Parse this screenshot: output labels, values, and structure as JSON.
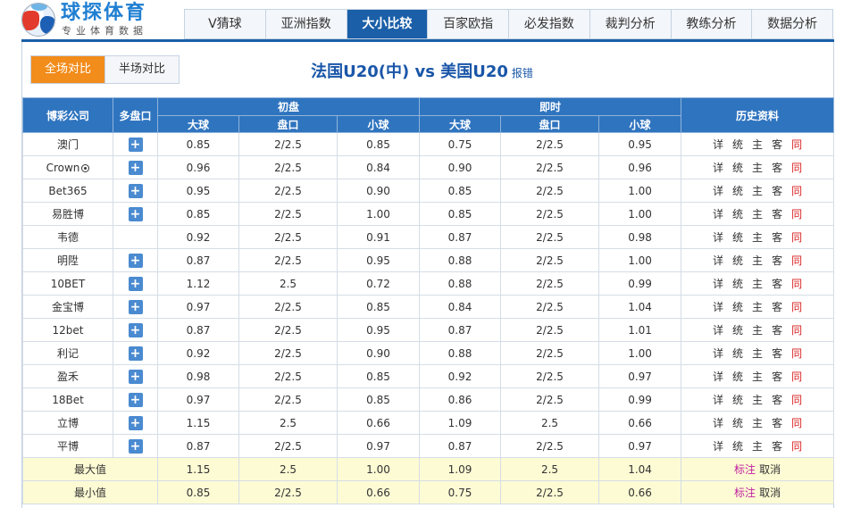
{
  "logo": {
    "title": "球探体育",
    "subtitle": "专业体育数据"
  },
  "nav": {
    "tabs": [
      "V猜球",
      "亚洲指数",
      "大小比较",
      "百家欧指",
      "必发指数",
      "裁判分析",
      "教练分析",
      "数据分析"
    ],
    "active_index": 2
  },
  "toggle": {
    "full": "全场对比",
    "half": "半场对比"
  },
  "match": {
    "title": "法国U20(中) vs 美国U20",
    "report": "报错"
  },
  "table": {
    "headers": {
      "company": "博彩公司",
      "multi": "多盘口",
      "initial": "初盘",
      "live": "即时",
      "history": "历史资料",
      "over": "大球",
      "line": "盘口",
      "under": "小球"
    },
    "plus_symbol": "+",
    "history_links": [
      "详",
      "统",
      "主",
      "客",
      "同"
    ],
    "rows": [
      {
        "company": "澳门",
        "plus": true,
        "i_over": "0.85",
        "i_line": "2/2.5",
        "i_under": "0.85",
        "l_over": "0.75",
        "l_line": "2/2.5",
        "l_under": "0.95"
      },
      {
        "company": "Crown",
        "plus": true,
        "ball": true,
        "i_over": "0.96",
        "i_line": "2/2.5",
        "i_under": "0.84",
        "l_over": "0.90",
        "l_line": "2/2.5",
        "l_under": "0.96"
      },
      {
        "company": "Bet365",
        "plus": true,
        "i_over": "0.95",
        "i_line": "2/2.5",
        "i_under": "0.90",
        "l_over": "0.85",
        "l_line": "2/2.5",
        "l_under": "1.00"
      },
      {
        "company": "易胜博",
        "plus": true,
        "i_over": "0.85",
        "i_line": "2/2.5",
        "i_under": "1.00",
        "l_over": "0.85",
        "l_line": "2/2.5",
        "l_under": "1.00"
      },
      {
        "company": "韦德",
        "plus": false,
        "i_over": "0.92",
        "i_line": "2/2.5",
        "i_under": "0.91",
        "l_over": "0.87",
        "l_line": "2/2.5",
        "l_under": "0.98"
      },
      {
        "company": "明陞",
        "plus": true,
        "i_over": "0.87",
        "i_line": "2/2.5",
        "i_under": "0.95",
        "l_over": "0.88",
        "l_line": "2/2.5",
        "l_under": "1.00"
      },
      {
        "company": "10BET",
        "plus": true,
        "i_over": "1.12",
        "i_line": "2.5",
        "i_under": "0.72",
        "l_over": "0.88",
        "l_line": "2/2.5",
        "l_under": "0.99"
      },
      {
        "company": "金宝博",
        "plus": true,
        "i_over": "0.97",
        "i_line": "2/2.5",
        "i_under": "0.85",
        "l_over": "0.84",
        "l_line": "2/2.5",
        "l_under": "1.04"
      },
      {
        "company": "12bet",
        "plus": true,
        "i_over": "0.87",
        "i_line": "2/2.5",
        "i_under": "0.95",
        "l_over": "0.87",
        "l_line": "2/2.5",
        "l_under": "1.01"
      },
      {
        "company": "利记",
        "plus": true,
        "i_over": "0.92",
        "i_line": "2/2.5",
        "i_under": "0.90",
        "l_over": "0.88",
        "l_line": "2/2.5",
        "l_under": "1.00"
      },
      {
        "company": "盈禾",
        "plus": true,
        "i_over": "0.98",
        "i_line": "2/2.5",
        "i_under": "0.85",
        "l_over": "0.92",
        "l_line": "2/2.5",
        "l_under": "0.97"
      },
      {
        "company": "18Bet",
        "plus": true,
        "i_over": "0.97",
        "i_line": "2/2.5",
        "i_under": "0.85",
        "l_over": "0.86",
        "l_line": "2/2.5",
        "l_under": "0.99"
      },
      {
        "company": "立博",
        "plus": true,
        "i_over": "1.15",
        "i_line": "2.5",
        "i_under": "0.66",
        "l_over": "1.09",
        "l_line": "2.5",
        "l_under": "0.66"
      },
      {
        "company": "平博",
        "plus": true,
        "i_over": "0.87",
        "i_line": "2/2.5",
        "i_under": "0.97",
        "l_over": "0.87",
        "l_line": "2/2.5",
        "l_under": "0.97"
      }
    ],
    "summary": [
      {
        "label": "最大值",
        "i_over": "1.15",
        "i_line": "2.5",
        "i_under": "1.00",
        "l_over": "1.09",
        "l_line": "2.5",
        "l_under": "1.04",
        "mark": "标注",
        "cancel": "取消"
      },
      {
        "label": "最小值",
        "i_over": "0.85",
        "i_line": "2/2.5",
        "i_under": "0.66",
        "l_over": "0.75",
        "l_line": "2/2.5",
        "l_under": "0.66",
        "mark": "标注",
        "cancel": "取消"
      }
    ]
  }
}
